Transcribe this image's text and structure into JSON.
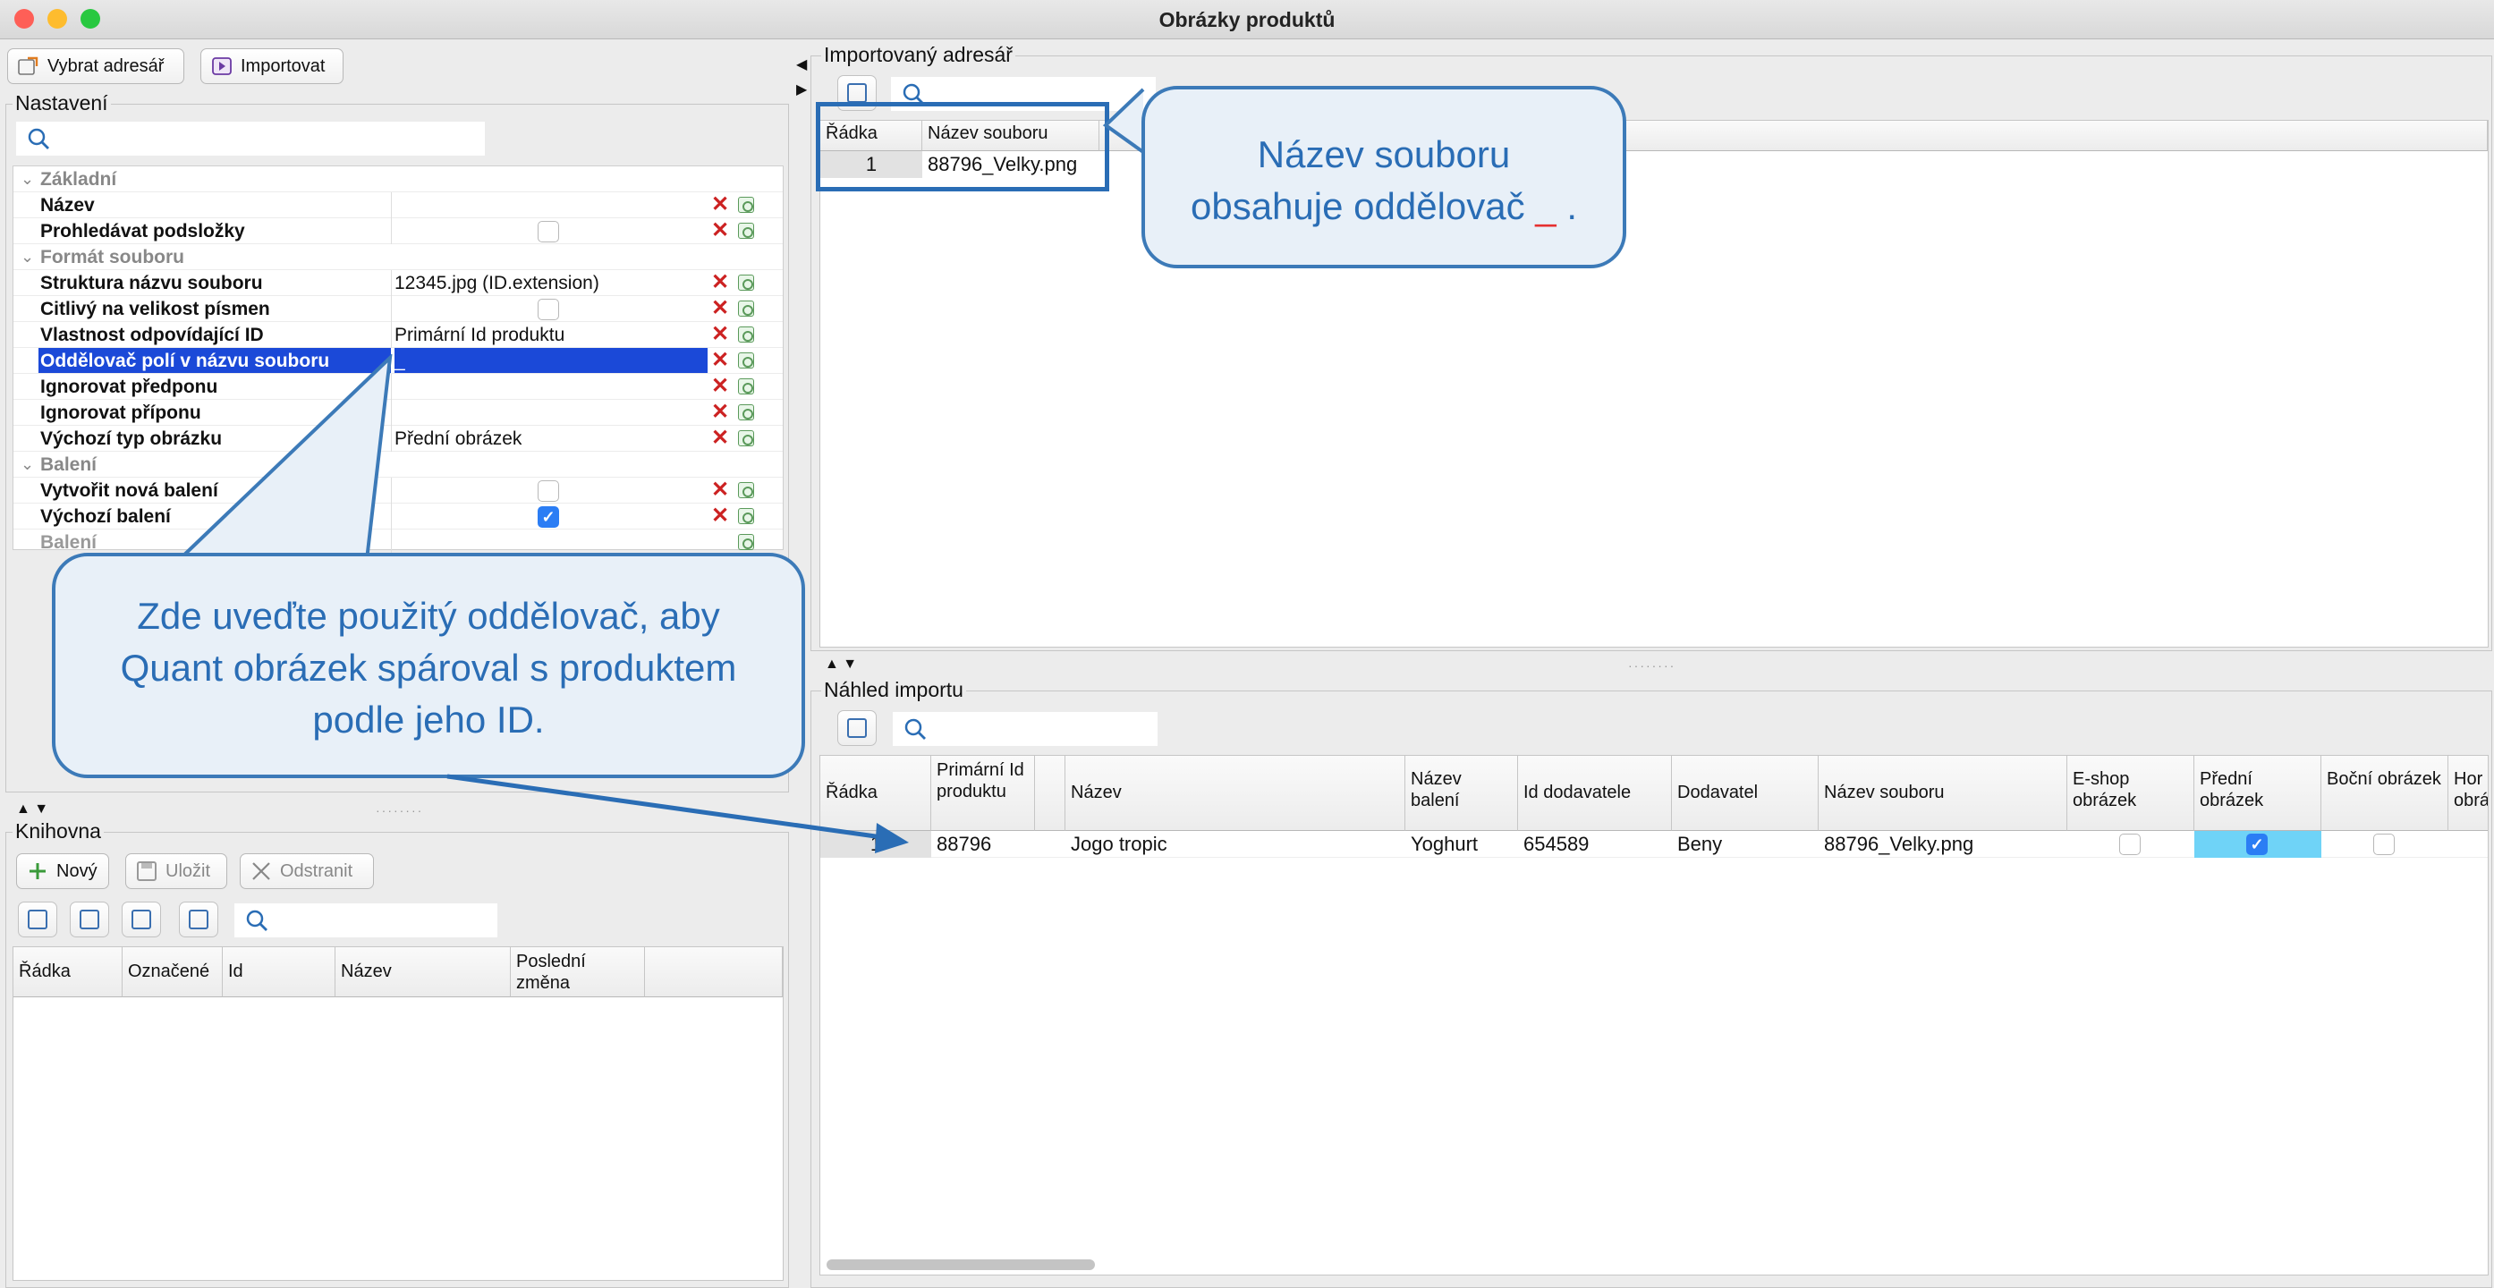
{
  "window": {
    "title": "Obrázky produktů"
  },
  "toolbar": {
    "select_dir_label": "Vybrat adresář",
    "import_label": "Importovat"
  },
  "settings": {
    "title": "Nastavení",
    "rows": [
      {
        "type": "category",
        "label": "Základní"
      },
      {
        "type": "prop",
        "label": "Název",
        "value": ""
      },
      {
        "type": "prop",
        "label": "Prohledávat podsložky",
        "checkbox": false
      },
      {
        "type": "category",
        "label": "Formát souboru"
      },
      {
        "type": "prop",
        "label": "Struktura názvu souboru",
        "value": "12345.jpg (ID.extension)"
      },
      {
        "type": "prop",
        "label": "Citlivý na velikost písmen",
        "checkbox": false
      },
      {
        "type": "prop",
        "label": "Vlastnost odpovídající ID",
        "value": "Primární Id produktu"
      },
      {
        "type": "prop",
        "label": "Oddělovač polí v názvu souboru",
        "value": "_",
        "selected": true
      },
      {
        "type": "prop",
        "label": "Ignorovat předponu",
        "value": ""
      },
      {
        "type": "prop",
        "label": "Ignorovat příponu",
        "value": ""
      },
      {
        "type": "prop",
        "label": "Výchozí typ obrázku",
        "value": "Přední obrázek"
      },
      {
        "type": "category",
        "label": "Balení"
      },
      {
        "type": "prop",
        "label": "Vytvořit nová balení",
        "checkbox": false
      },
      {
        "type": "prop",
        "label": "Výchozí balení",
        "checkbox": true
      },
      {
        "type": "prop",
        "label": "Balení",
        "value": "",
        "disabled": true
      }
    ]
  },
  "library": {
    "title": "Knihovna",
    "new_label": "Nový",
    "save_label": "Uložit",
    "delete_label": "Odstranit",
    "columns": [
      "Řádka",
      "Označené",
      "Id",
      "Název",
      "Poslední změna"
    ]
  },
  "imported_dir": {
    "title": "Importovaný adresář",
    "columns": [
      "Řádka",
      "Název souboru"
    ],
    "rows": [
      {
        "row": "1",
        "file": "88796_Velky.png"
      }
    ]
  },
  "preview": {
    "title": "Náhled importu",
    "columns": [
      "Řádka",
      "Primární Id produktu",
      "",
      "Název",
      "Název balení",
      "Id dodavatele",
      "Dodavatel",
      "Název souboru",
      "E-shop obrázek",
      "Přední obrázek",
      "Boční obrázek",
      "Hor obrá"
    ],
    "rows": [
      {
        "row": "1",
        "primary_id": "88796",
        "name": "Jogo tropic",
        "package": "Yoghurt",
        "supplier_id": "654589",
        "supplier": "Beny",
        "file": "88796_Velky.png",
        "eshop": false,
        "front": true,
        "side": false
      }
    ]
  },
  "callouts": {
    "top_line1": "Název souboru",
    "top_line2_prefix": "obsahuje oddělovač",
    "top_sep": "_",
    "top_end": ".",
    "bottom_line1": "Zde uveďte použitý oddělovač, aby",
    "bottom_line2": "Quant obrázek spároval s produktem",
    "bottom_line3": "podle jeho ID."
  },
  "colors": {
    "selection": "#1b49d8",
    "callout_border": "#3c7ab8",
    "callout_text": "#2a6db5",
    "checked_cell": "#6fd3f7"
  }
}
